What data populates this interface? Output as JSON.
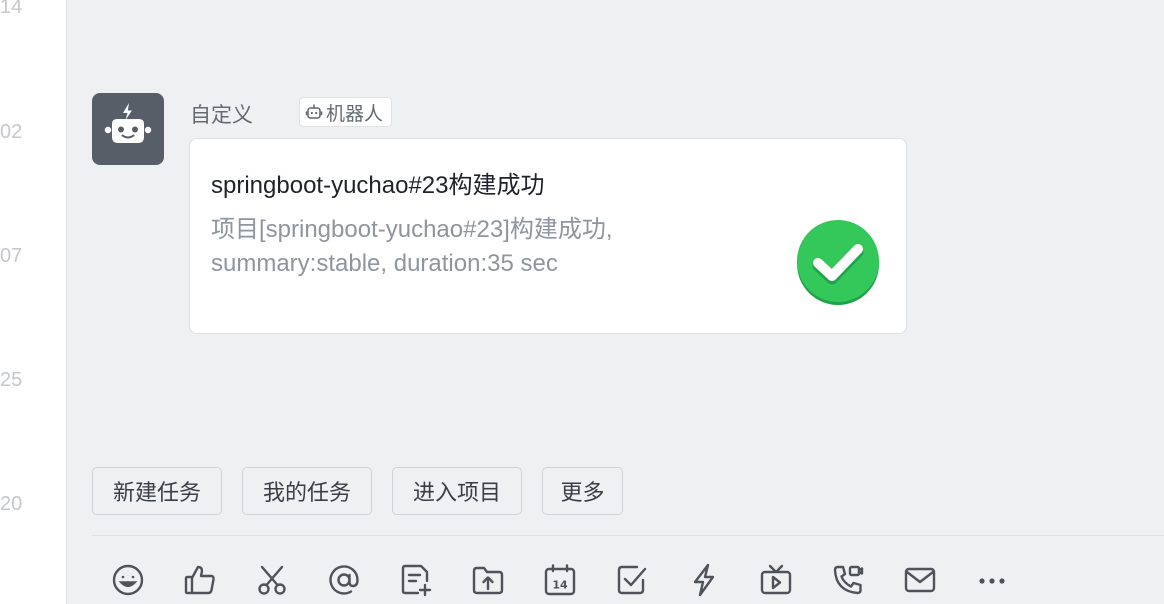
{
  "timeline_numbers": [
    "14",
    "02",
    "07",
    "25",
    "20"
  ],
  "message": {
    "sender": "自定义",
    "bot_tag": "机器人",
    "card": {
      "title": "springboot-yuchao#23构建成功",
      "body_line1": "项目[springboot-yuchao#23]构建成功,",
      "body_line2": "summary:stable, duration:35 sec",
      "status_icon": "success-check-icon",
      "status_color": "#34c759"
    }
  },
  "quick_actions": [
    "新建任务",
    "我的任务",
    "进入项目",
    "更多"
  ],
  "toolbar_icons": [
    "emoji-icon",
    "thumbs-up-icon",
    "scissors-icon",
    "mention-icon",
    "doc-add-icon",
    "folder-upload-icon",
    "calendar-icon",
    "task-check-icon",
    "lightning-icon",
    "video-icon",
    "phone-icon",
    "mail-icon",
    "more-icon"
  ],
  "calendar_day": "14",
  "colors": {
    "background": "#eff0f2",
    "avatar": "#585e67",
    "card_border": "#dee0e3",
    "muted_text": "#8f959e"
  }
}
